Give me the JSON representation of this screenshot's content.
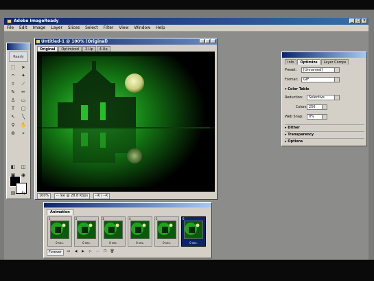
{
  "app": {
    "title": "Adobe ImageReady"
  },
  "menu": [
    "File",
    "Edit",
    "Image",
    "Layer",
    "Slices",
    "Select",
    "Filter",
    "View",
    "Window",
    "Help"
  ],
  "window_buttons": {
    "minimize": "_",
    "maximize": "□",
    "close": "×"
  },
  "document": {
    "title": "Untitled-1 @ 100% (Original)",
    "tabs": [
      "Original",
      "Optimized",
      "2-Up",
      "4-Up"
    ],
    "active_tab": "Original",
    "zoom": "100%",
    "status_size": "-- /ee @ 28.8 Kbps",
    "status_value": "--K / --K"
  },
  "optimize_panel": {
    "tabs": [
      "Info",
      "Optimize",
      "Layer Comps"
    ],
    "active_tab": "Optimize",
    "preset_label": "Preset:",
    "preset_value": "[Unnamed]",
    "format_label": "Format:",
    "format_value": "GIF",
    "color_table_label": "Color Table",
    "reduction_label": "Reduction:",
    "reduction_value": "Selective",
    "colors_label": "Colors:",
    "colors_value": "256",
    "web_snap_label": "Web Snap:",
    "web_snap_value": "0%",
    "sections": [
      "Dither",
      "Transparency",
      "Options"
    ]
  },
  "animation_panel": {
    "tab": "Animation",
    "frames": [
      {
        "num": "1",
        "delay": "0 sec.",
        "selected": false
      },
      {
        "num": "2",
        "delay": "0 sec.",
        "selected": false
      },
      {
        "num": "3",
        "delay": "0 sec.",
        "selected": false
      },
      {
        "num": "4",
        "delay": "0 sec.",
        "selected": false
      },
      {
        "num": "5",
        "delay": "0 sec.",
        "selected": false
      },
      {
        "num": "6",
        "delay": "0 sec.",
        "selected": true
      }
    ],
    "loop_value": "Forever"
  },
  "toolbox": {
    "logo": "Ready"
  },
  "colors": {
    "accent": "#0a246a",
    "chrome": "#d4d0c8",
    "glow": "#1fc21f"
  }
}
